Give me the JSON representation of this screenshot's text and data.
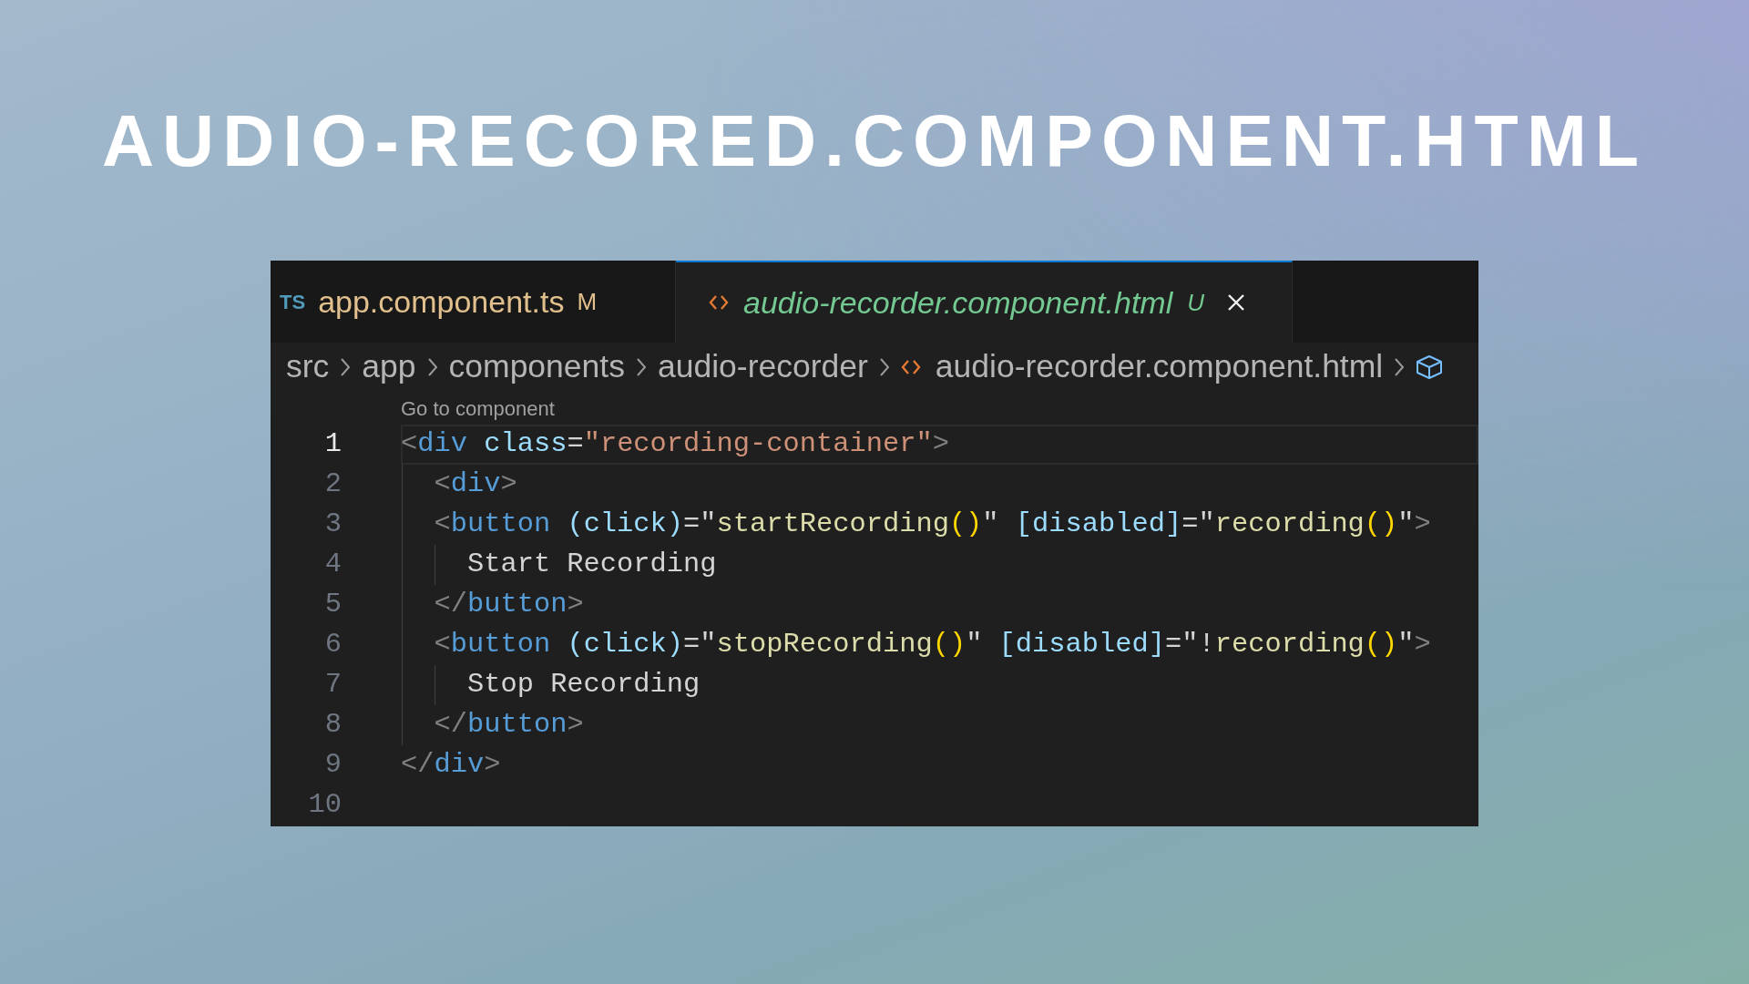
{
  "title": "AUDIO-RECORED.COMPONENT.HTML",
  "tabs": [
    {
      "kind": "ts",
      "badge": "TS",
      "label": "app.component.ts",
      "status": "M",
      "selected": false
    },
    {
      "kind": "html",
      "label": "audio-recorder.component.html",
      "status": "U",
      "selected": true,
      "close": true
    }
  ],
  "breadcrumbs": [
    {
      "kind": "folder",
      "label": "src"
    },
    {
      "kind": "folder",
      "label": "app"
    },
    {
      "kind": "folder",
      "label": "components"
    },
    {
      "kind": "folder",
      "label": "audio-recorder"
    },
    {
      "kind": "html",
      "label": "audio-recorder.component.html"
    },
    {
      "kind": "symbol"
    }
  ],
  "codelens": "Go to component",
  "lines": [
    {
      "number": "1",
      "active": true,
      "tokens": [
        {
          "kind": "bracket",
          "text": "<"
        },
        {
          "kind": "tag",
          "text": "div"
        },
        {
          "kind": "attr",
          "text": " class"
        },
        {
          "kind": "op",
          "text": "="
        },
        {
          "kind": "string",
          "text": "\"recording-container\""
        },
        {
          "kind": "bracket",
          "text": ">"
        }
      ]
    },
    {
      "number": "2",
      "active": false,
      "tokens": [
        {
          "kind": "bracket",
          "text": "  <"
        },
        {
          "kind": "tag",
          "text": "div"
        },
        {
          "kind": "bracket",
          "text": ">"
        }
      ]
    },
    {
      "number": "3",
      "active": false,
      "tokens": [
        {
          "kind": "bracket",
          "text": "  <"
        },
        {
          "kind": "tag",
          "text": "button"
        },
        {
          "kind": "attr",
          "text": " (click)"
        },
        {
          "kind": "op",
          "text": "=\""
        },
        {
          "kind": "call",
          "text": "startRecording"
        },
        {
          "kind": "paren",
          "text": "()"
        },
        {
          "kind": "op",
          "text": "\""
        },
        {
          "kind": "attr",
          "text": " [disabled]"
        },
        {
          "kind": "op",
          "text": "=\""
        },
        {
          "kind": "call",
          "text": "recording"
        },
        {
          "kind": "paren",
          "text": "()"
        },
        {
          "kind": "op",
          "text": "\""
        },
        {
          "kind": "bracket",
          "text": ">"
        }
      ]
    },
    {
      "number": "4",
      "active": false,
      "tokens": [
        {
          "kind": "text",
          "text": "    Start Recording"
        }
      ]
    },
    {
      "number": "5",
      "active": false,
      "tokens": [
        {
          "kind": "bracket",
          "text": "  </"
        },
        {
          "kind": "tag",
          "text": "button"
        },
        {
          "kind": "bracket",
          "text": ">"
        }
      ]
    },
    {
      "number": "6",
      "active": false,
      "tokens": [
        {
          "kind": "bracket",
          "text": "  <"
        },
        {
          "kind": "tag",
          "text": "button"
        },
        {
          "kind": "attr",
          "text": " (click)"
        },
        {
          "kind": "op",
          "text": "=\""
        },
        {
          "kind": "call",
          "text": "stopRecording"
        },
        {
          "kind": "paren",
          "text": "()"
        },
        {
          "kind": "op",
          "text": "\""
        },
        {
          "kind": "attr",
          "text": " [disabled]"
        },
        {
          "kind": "op",
          "text": "=\"!"
        },
        {
          "kind": "call",
          "text": "recording"
        },
        {
          "kind": "paren",
          "text": "()"
        },
        {
          "kind": "op",
          "text": "\""
        },
        {
          "kind": "bracket",
          "text": ">"
        }
      ]
    },
    {
      "number": "7",
      "active": false,
      "tokens": [
        {
          "kind": "text",
          "text": "    Stop Recording"
        }
      ]
    },
    {
      "number": "8",
      "active": false,
      "tokens": [
        {
          "kind": "bracket",
          "text": "  </"
        },
        {
          "kind": "tag",
          "text": "button"
        },
        {
          "kind": "bracket",
          "text": ">"
        }
      ]
    },
    {
      "number": "9",
      "active": false,
      "tokens": [
        {
          "kind": "bracket",
          "text": "</"
        },
        {
          "kind": "tag",
          "text": "div"
        },
        {
          "kind": "bracket",
          "text": ">"
        }
      ]
    },
    {
      "number": "10",
      "active": false
    }
  ]
}
